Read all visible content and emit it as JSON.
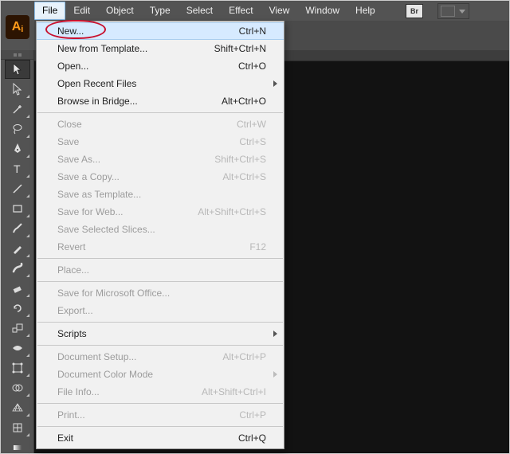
{
  "menubar": {
    "items": [
      {
        "label": "File",
        "active": true
      },
      {
        "label": "Edit",
        "active": false
      },
      {
        "label": "Object",
        "active": false
      },
      {
        "label": "Type",
        "active": false
      },
      {
        "label": "Select",
        "active": false
      },
      {
        "label": "Effect",
        "active": false
      },
      {
        "label": "View",
        "active": false
      },
      {
        "label": "Window",
        "active": false
      },
      {
        "label": "Help",
        "active": false
      }
    ]
  },
  "ai_badge": "Ai",
  "bridge_badge": "Br",
  "file_menu": [
    {
      "label": "New...",
      "shortcut": "Ctrl+N",
      "enabled": true,
      "hover": true
    },
    {
      "label": "New from Template...",
      "shortcut": "Shift+Ctrl+N",
      "enabled": true
    },
    {
      "label": "Open...",
      "shortcut": "Ctrl+O",
      "enabled": true
    },
    {
      "label": "Open Recent Files",
      "shortcut": "",
      "enabled": true,
      "submenu": true
    },
    {
      "label": "Browse in Bridge...",
      "shortcut": "Alt+Ctrl+O",
      "enabled": true
    },
    {
      "sep": true
    },
    {
      "label": "Close",
      "shortcut": "Ctrl+W",
      "enabled": false
    },
    {
      "label": "Save",
      "shortcut": "Ctrl+S",
      "enabled": false
    },
    {
      "label": "Save As...",
      "shortcut": "Shift+Ctrl+S",
      "enabled": false
    },
    {
      "label": "Save a Copy...",
      "shortcut": "Alt+Ctrl+S",
      "enabled": false
    },
    {
      "label": "Save as Template...",
      "shortcut": "",
      "enabled": false
    },
    {
      "label": "Save for Web...",
      "shortcut": "Alt+Shift+Ctrl+S",
      "enabled": false
    },
    {
      "label": "Save Selected Slices...",
      "shortcut": "",
      "enabled": false
    },
    {
      "label": "Revert",
      "shortcut": "F12",
      "enabled": false
    },
    {
      "sep": true
    },
    {
      "label": "Place...",
      "shortcut": "",
      "enabled": false
    },
    {
      "sep": true
    },
    {
      "label": "Save for Microsoft Office...",
      "shortcut": "",
      "enabled": false
    },
    {
      "label": "Export...",
      "shortcut": "",
      "enabled": false
    },
    {
      "sep": true
    },
    {
      "label": "Scripts",
      "shortcut": "",
      "enabled": true,
      "submenu": true
    },
    {
      "sep": true
    },
    {
      "label": "Document Setup...",
      "shortcut": "Alt+Ctrl+P",
      "enabled": false
    },
    {
      "label": "Document Color Mode",
      "shortcut": "",
      "enabled": false,
      "submenu": true
    },
    {
      "label": "File Info...",
      "shortcut": "Alt+Shift+Ctrl+I",
      "enabled": false
    },
    {
      "sep": true
    },
    {
      "label": "Print...",
      "shortcut": "Ctrl+P",
      "enabled": false
    },
    {
      "sep": true
    },
    {
      "label": "Exit",
      "shortcut": "Ctrl+Q",
      "enabled": true
    }
  ],
  "tools": [
    {
      "name": "selection-tool",
      "selected": true,
      "corner": false
    },
    {
      "name": "direct-selection-tool",
      "selected": false,
      "corner": true
    },
    {
      "name": "magic-wand-tool",
      "selected": false,
      "corner": true
    },
    {
      "name": "lasso-tool",
      "selected": false,
      "corner": true
    },
    {
      "name": "pen-tool",
      "selected": false,
      "corner": true
    },
    {
      "name": "type-tool",
      "selected": false,
      "corner": true
    },
    {
      "name": "line-segment-tool",
      "selected": false,
      "corner": true
    },
    {
      "name": "rectangle-tool",
      "selected": false,
      "corner": true
    },
    {
      "name": "paintbrush-tool",
      "selected": false,
      "corner": true
    },
    {
      "name": "pencil-tool",
      "selected": false,
      "corner": true
    },
    {
      "name": "blob-brush-tool",
      "selected": false,
      "corner": true
    },
    {
      "name": "eraser-tool",
      "selected": false,
      "corner": true
    },
    {
      "name": "rotate-tool",
      "selected": false,
      "corner": true
    },
    {
      "name": "scale-tool",
      "selected": false,
      "corner": true
    },
    {
      "name": "width-tool",
      "selected": false,
      "corner": true
    },
    {
      "name": "free-transform-tool",
      "selected": false,
      "corner": true
    },
    {
      "name": "shape-builder-tool",
      "selected": false,
      "corner": true
    },
    {
      "name": "perspective-grid-tool",
      "selected": false,
      "corner": true
    },
    {
      "name": "mesh-tool",
      "selected": false,
      "corner": true
    },
    {
      "name": "gradient-tool",
      "selected": false,
      "corner": true
    }
  ],
  "annotation": {
    "highlights": "New..."
  }
}
